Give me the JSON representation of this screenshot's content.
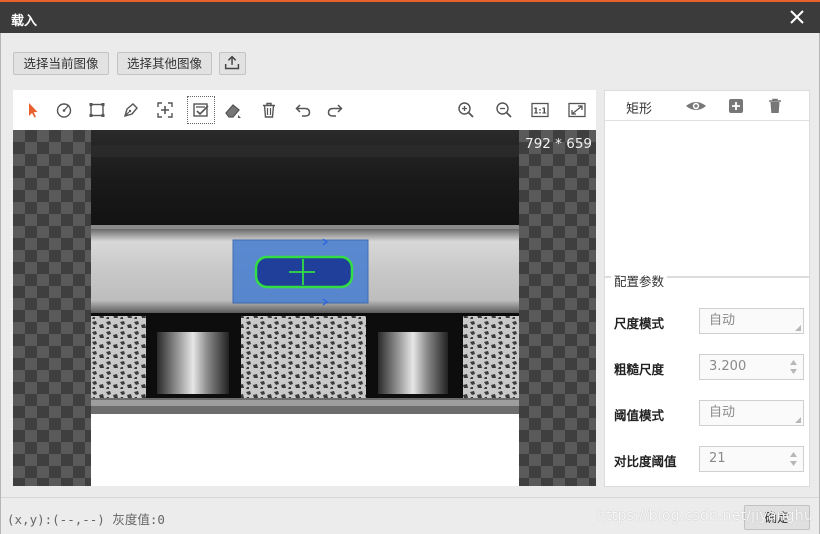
{
  "window": {
    "title": "载入"
  },
  "top_buttons": {
    "select_current": "选择当前图像",
    "select_other": "选择其他图像"
  },
  "toolbar": {
    "tools": [
      "pointer-arrow-icon",
      "circle-tool-icon",
      "rectangle-tool-icon",
      "pen-tool-icon",
      "crosshair-add-icon",
      "checklist-select-icon",
      "eraser-icon",
      "trash-icon",
      "undo-icon",
      "redo-icon",
      "zoom-in-icon",
      "zoom-out-icon",
      "actual-size-icon",
      "fit-window-icon"
    ],
    "actual_size_label": "1:1"
  },
  "canvas": {
    "image_size": "792 * 659"
  },
  "shape_panel": {
    "shape_label": "矩形"
  },
  "config": {
    "title": "配置参数",
    "rows": [
      {
        "label": "尺度模式",
        "value": "自动"
      },
      {
        "label": "粗糙尺度",
        "value": "3.200"
      },
      {
        "label": "阈值模式",
        "value": "自动"
      },
      {
        "label": "对比度阈值",
        "value": "21"
      }
    ]
  },
  "statusbar": {
    "coords": "(x,y):(--,--)",
    "gray_label": "灰度值:0",
    "ok_label": "确定",
    "watermark": "https://blog.csdn.net/jiyanghu"
  },
  "colors": {
    "accent": "#e8612c",
    "selection": "#4a7fd0",
    "contour": "#33dd44"
  }
}
